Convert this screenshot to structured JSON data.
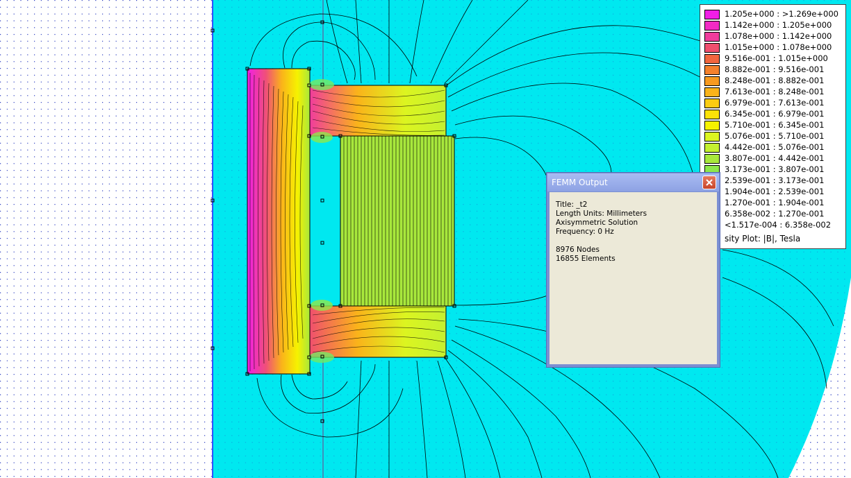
{
  "legend": {
    "items": [
      {
        "label": "1.205e+000 : >1.269e+000",
        "color": "#f01ee6"
      },
      {
        "label": "1.142e+000 : 1.205e+000",
        "color": "#f22ac4"
      },
      {
        "label": "1.078e+000 : 1.142e+000",
        "color": "#f03c9c"
      },
      {
        "label": "1.015e+000 : 1.078e+000",
        "color": "#f04f6e"
      },
      {
        "label": "9.516e-001 : 1.015e+000",
        "color": "#f2663e"
      },
      {
        "label": "8.882e-001 : 9.516e-001",
        "color": "#f5812c"
      },
      {
        "label": "8.248e-001 : 8.882e-001",
        "color": "#f89a20"
      },
      {
        "label": "7.613e-001 : 8.248e-001",
        "color": "#fab31a"
      },
      {
        "label": "6.979e-001 : 7.613e-001",
        "color": "#fbcc12"
      },
      {
        "label": "6.345e-001 : 6.979e-001",
        "color": "#fce208"
      },
      {
        "label": "5.710e-001 : 6.345e-001",
        "color": "#f6f200"
      },
      {
        "label": "5.076e-001 : 5.710e-001",
        "color": "#dcf520"
      },
      {
        "label": "4.442e-001 : 5.076e-001",
        "color": "#c4f030"
      },
      {
        "label": "3.807e-001 : 4.442e-001",
        "color": "#a8e83c"
      },
      {
        "label": "3.173e-001 : 3.807e-001",
        "color": "#8ee84a"
      },
      {
        "label": "2.539e-001 : 3.173e-001",
        "color": "#74ea62"
      },
      {
        "label": "1.904e-001 : 2.539e-001",
        "color": "#5aec82"
      },
      {
        "label": "1.270e-001 : 1.904e-001",
        "color": "#40eea4"
      },
      {
        "label": "6.358e-002 : 1.270e-001",
        "color": "#26f0c8"
      },
      {
        "label": "<1.517e-004 : 6.358e-002",
        "color": "#10f0ec"
      }
    ],
    "title": "sity Plot: |B|, Tesla"
  },
  "dialog": {
    "title": "FEMM Output",
    "title_line": "Title:  _t2",
    "units_line": "Length Units: Millimeters",
    "solution_line": "Axisymmetric Solution",
    "frequency_line": "Frequency: 0 Hz",
    "nodes_line": "8976 Nodes",
    "elements_line": "16855 Elements"
  },
  "colors": {
    "background_field": "#00e8f0",
    "grid_dot": "#2a3cc0",
    "axis_line": "#1a1aff"
  }
}
